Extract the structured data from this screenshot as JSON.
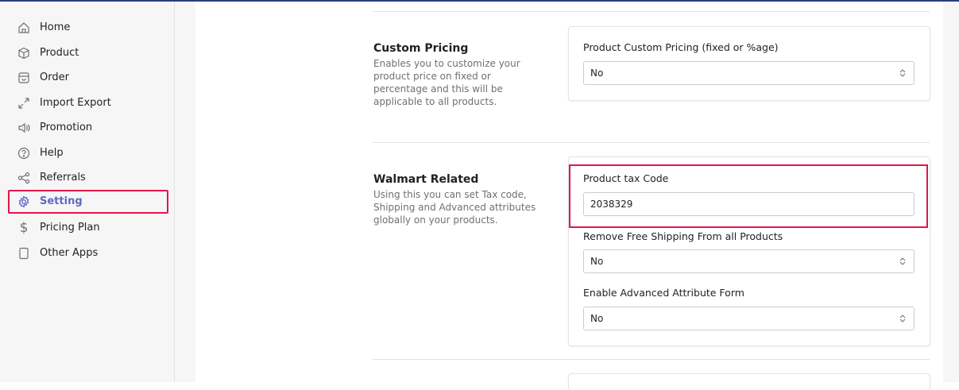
{
  "sidebar": {
    "items": [
      {
        "label": "Home",
        "icon": "home-icon"
      },
      {
        "label": "Product",
        "icon": "product-icon"
      },
      {
        "label": "Order",
        "icon": "order-icon"
      },
      {
        "label": "Import Export",
        "icon": "import-export-icon"
      },
      {
        "label": "Promotion",
        "icon": "promotion-icon"
      },
      {
        "label": "Help",
        "icon": "help-icon"
      },
      {
        "label": "Referrals",
        "icon": "referrals-icon"
      },
      {
        "label": "Setting",
        "icon": "gear-icon",
        "active": true
      },
      {
        "label": "Pricing Plan",
        "icon": "dollar-icon"
      },
      {
        "label": "Other Apps",
        "icon": "apps-icon"
      }
    ]
  },
  "custom_pricing": {
    "title": "Custom Pricing",
    "description": "Enables you to customize your product price on fixed or percentage and this will be applicable to all products.",
    "field_label": "Product Custom Pricing (fixed or %age)",
    "field_value": "No"
  },
  "walmart_related": {
    "title": "Walmart Related",
    "description": "Using this you can set Tax code, Shipping and Advanced attributes globally on your products.",
    "tax_code_label": "Product tax Code",
    "tax_code_value": "2038329",
    "free_shipping_label": "Remove Free Shipping From all Products",
    "free_shipping_value": "No",
    "advanced_attr_label": "Enable Advanced Attribute Form",
    "advanced_attr_value": "No"
  },
  "colors": {
    "accent": "#5c6ac4",
    "highlight": "#e0174a"
  }
}
